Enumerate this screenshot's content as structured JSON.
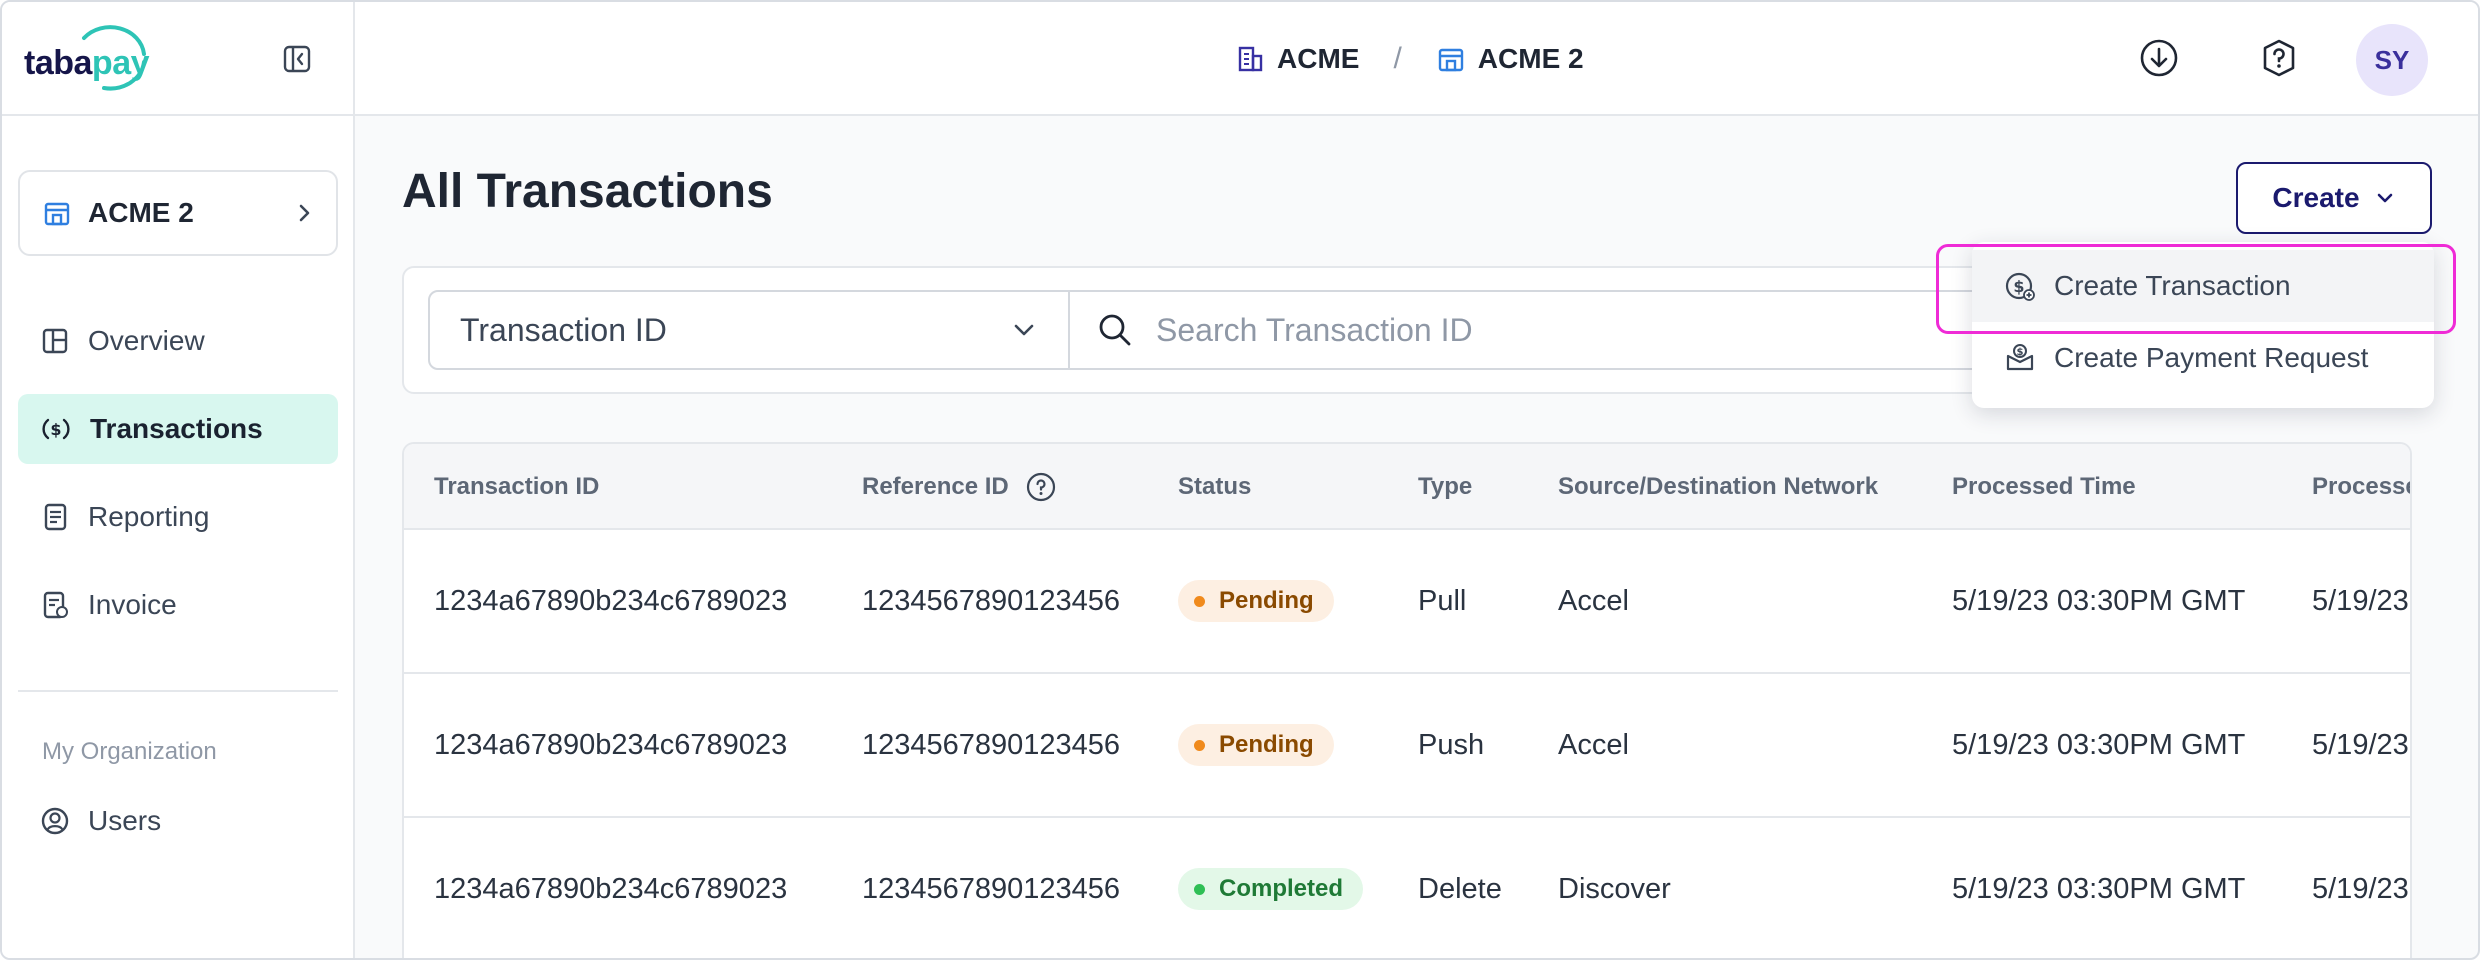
{
  "logo": {
    "part1": "taba",
    "part2": "pay"
  },
  "sidebar": {
    "org_card": {
      "label": "ACME 2"
    },
    "items": [
      {
        "label": "Overview"
      },
      {
        "label": "Transactions"
      },
      {
        "label": "Reporting"
      },
      {
        "label": "Invoice"
      }
    ],
    "section_label": "My Organization",
    "org_items": [
      {
        "label": "Users"
      }
    ]
  },
  "header": {
    "breadcrumb": [
      {
        "label": "ACME"
      },
      {
        "label": "ACME 2"
      }
    ],
    "separator": "/",
    "avatar_initials": "SY"
  },
  "main": {
    "title": "All Transactions",
    "create_label": "Create",
    "filter": {
      "selected": "Transaction ID"
    },
    "search": {
      "placeholder": "Search Transaction ID"
    }
  },
  "create_menu": {
    "items": [
      {
        "label": "Create Transaction",
        "icon": "dollar-circle-plus-icon"
      },
      {
        "label": "Create Payment Request",
        "icon": "payment-request-icon"
      }
    ]
  },
  "table": {
    "columns": [
      "Transaction ID",
      "Reference ID",
      "Status",
      "Type",
      "Source/Destination Network",
      "Processed Time",
      "Processe"
    ],
    "rows": [
      {
        "transaction_id": "1234a67890b234c6789023",
        "reference_id": "1234567890123456",
        "status": "Pending",
        "type": "Pull",
        "network": "Accel",
        "processed_time": "5/19/23 03:30PM GMT",
        "processed_date_cut": "5/19/23"
      },
      {
        "transaction_id": "1234a67890b234c6789023",
        "reference_id": "1234567890123456",
        "status": "Pending",
        "type": "Push",
        "network": "Accel",
        "processed_time": "5/19/23 03:30PM GMT",
        "processed_date_cut": "5/19/23"
      },
      {
        "transaction_id": "1234a67890b234c6789023",
        "reference_id": "1234567890123456",
        "status": "Completed",
        "type": "Delete",
        "network": "Discover",
        "processed_time": "5/19/23 03:30PM GMT",
        "processed_date_cut": "5/19/23"
      }
    ]
  },
  "colors": {
    "brand_navy": "#1b1a6e",
    "brand_teal": "#2ec4b6",
    "active_nav": "#d8f7ef",
    "pending": "#f08a1c",
    "completed": "#2fbf55",
    "highlight": "#ef2bd6"
  }
}
